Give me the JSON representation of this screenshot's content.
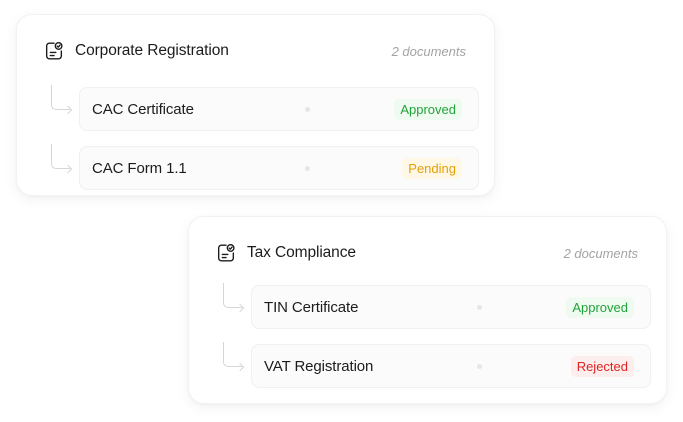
{
  "groups": [
    {
      "title": "Corporate Registration",
      "count": "2 documents",
      "documents": [
        {
          "name": "CAC Certificate",
          "status": "Approved"
        },
        {
          "name": "CAC Form 1.1",
          "status": "Pending"
        }
      ]
    },
    {
      "title": "Tax Compliance",
      "count": "2 documents",
      "documents": [
        {
          "name": "TIN Certificate",
          "status": "Approved"
        },
        {
          "name": "VAT Registration",
          "status": "Rejected"
        }
      ]
    }
  ],
  "status_colors": {
    "Approved": {
      "text": "#22a33a",
      "bg": "#effaf0"
    },
    "Pending": {
      "text": "#e3a008",
      "bg": "#fff8e6"
    },
    "Rejected": {
      "text": "#e02424",
      "bg": "#fdeeee"
    }
  },
  "icons": {
    "group": "document-check-icon",
    "connector": "tree-branch-icon"
  }
}
